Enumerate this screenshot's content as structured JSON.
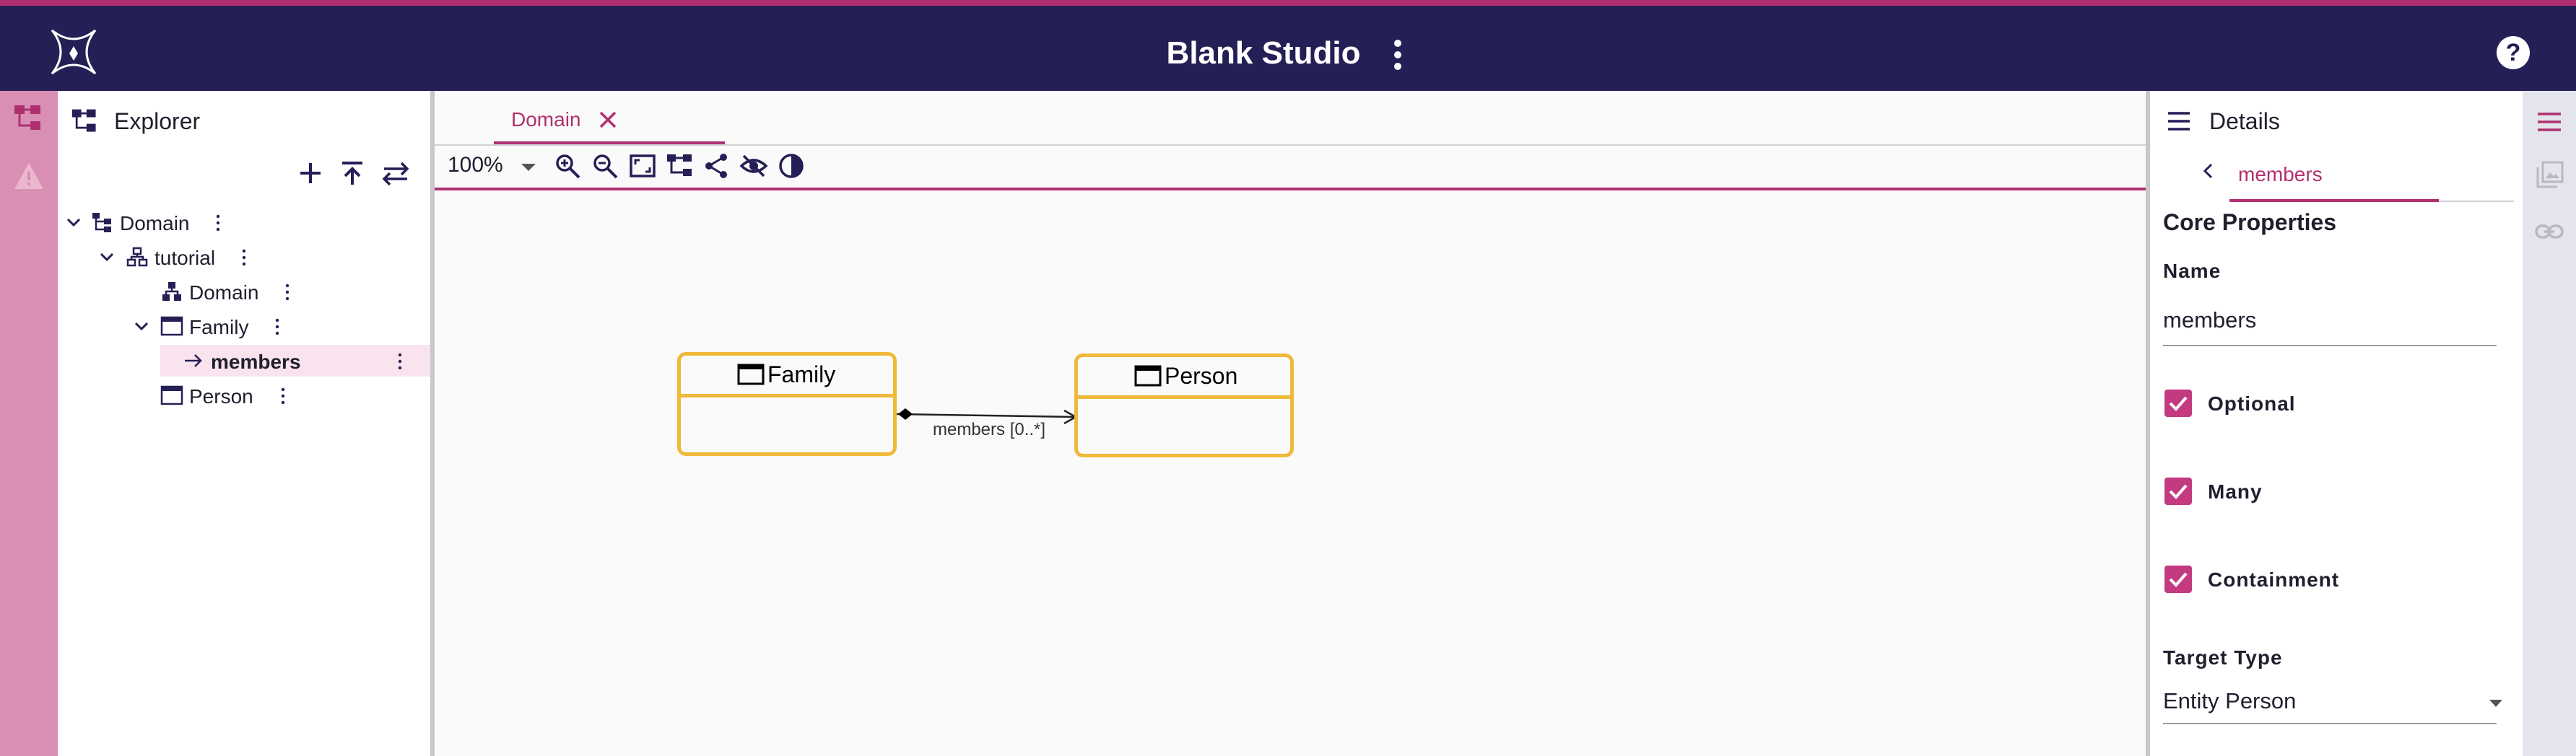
{
  "header": {
    "title": "Blank Studio",
    "help_label": "?"
  },
  "explorer": {
    "title": "Explorer",
    "tree": [
      {
        "label": "Domain",
        "icon": "tree-icon"
      },
      {
        "label": "tutorial",
        "icon": "package-icon"
      },
      {
        "label": "Domain",
        "icon": "domain-icon"
      },
      {
        "label": "Family",
        "icon": "entity-icon"
      },
      {
        "label": "members",
        "icon": "arrow-right-icon"
      },
      {
        "label": "Person",
        "icon": "entity-icon"
      }
    ]
  },
  "editor": {
    "tab": {
      "label": "Domain"
    },
    "zoom": "100%",
    "diagram": {
      "nodes": [
        {
          "label": "Family"
        },
        {
          "label": "Person"
        }
      ],
      "edge_label": "members [0..*]"
    }
  },
  "details": {
    "title": "Details",
    "breadcrumb": "members",
    "section": "Core Properties",
    "name_label": "Name",
    "name_value": "members",
    "optional_label": "Optional",
    "many_label": "Many",
    "containment_label": "Containment",
    "target_label": "Target Type",
    "target_value": "Entity Person",
    "optional_checked": true,
    "many_checked": true,
    "containment_checked": true
  },
  "colors": {
    "header_bg": "#241f55",
    "accent": "#b0306f",
    "node_border": "#f0b93a",
    "left_rail": "#d98fb4"
  }
}
